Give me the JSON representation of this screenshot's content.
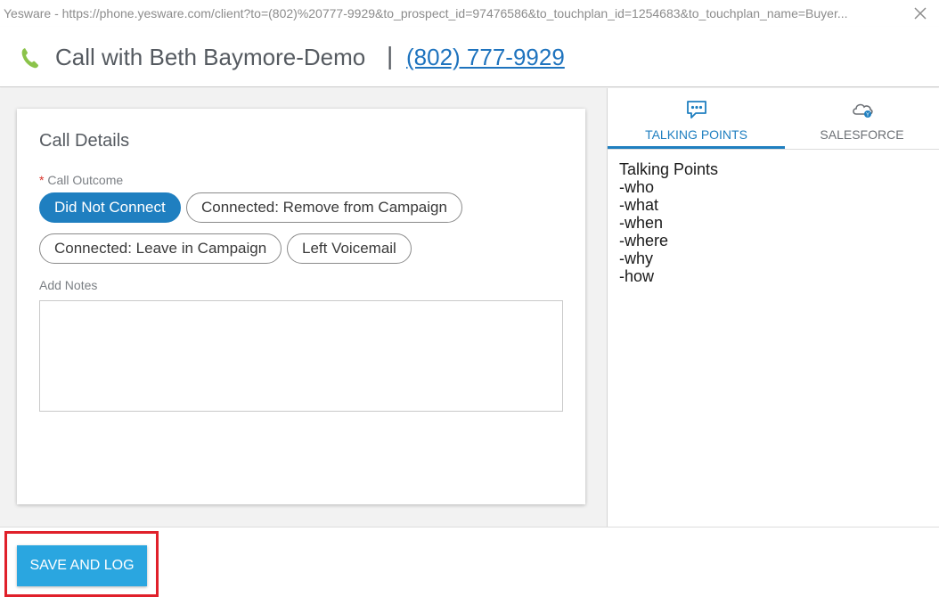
{
  "window": {
    "title": "Yesware - https://phone.yesware.com/client?to=(802)%20777-9929&to_prospect_id=97476586&to_touchplan_id=1254683&to_touchplan_name=Buyer..."
  },
  "header": {
    "call_title": "Call with Beth Baymore-Demo",
    "separator": "|",
    "phone_number": "(802) 777-9929",
    "accent_color": "#1e73be",
    "phone_icon_color": "#8bc34a"
  },
  "call_details": {
    "title": "Call Details",
    "outcome_required_mark": "*",
    "outcome_label": "Call Outcome",
    "outcomes": [
      {
        "label": "Did Not Connect",
        "selected": true
      },
      {
        "label": "Connected: Remove from Campaign",
        "selected": false
      },
      {
        "label": "Connected: Leave in Campaign",
        "selected": false
      },
      {
        "label": "Left Voicemail",
        "selected": false
      }
    ],
    "notes_label": "Add Notes",
    "notes_value": ""
  },
  "tabs": [
    {
      "label": "TALKING POINTS",
      "icon": "chat-bubble-icon",
      "active": true
    },
    {
      "label": "SALESFORCE",
      "icon": "salesforce-cloud-icon",
      "active": false
    }
  ],
  "talking_points": {
    "lines": [
      "Talking Points",
      "-who",
      "-what",
      "-when",
      "-where",
      "-why",
      "-how"
    ]
  },
  "footer": {
    "save_label": "SAVE AND LOG",
    "button_color": "#2aa6e0",
    "highlight_color": "#e0202a"
  }
}
